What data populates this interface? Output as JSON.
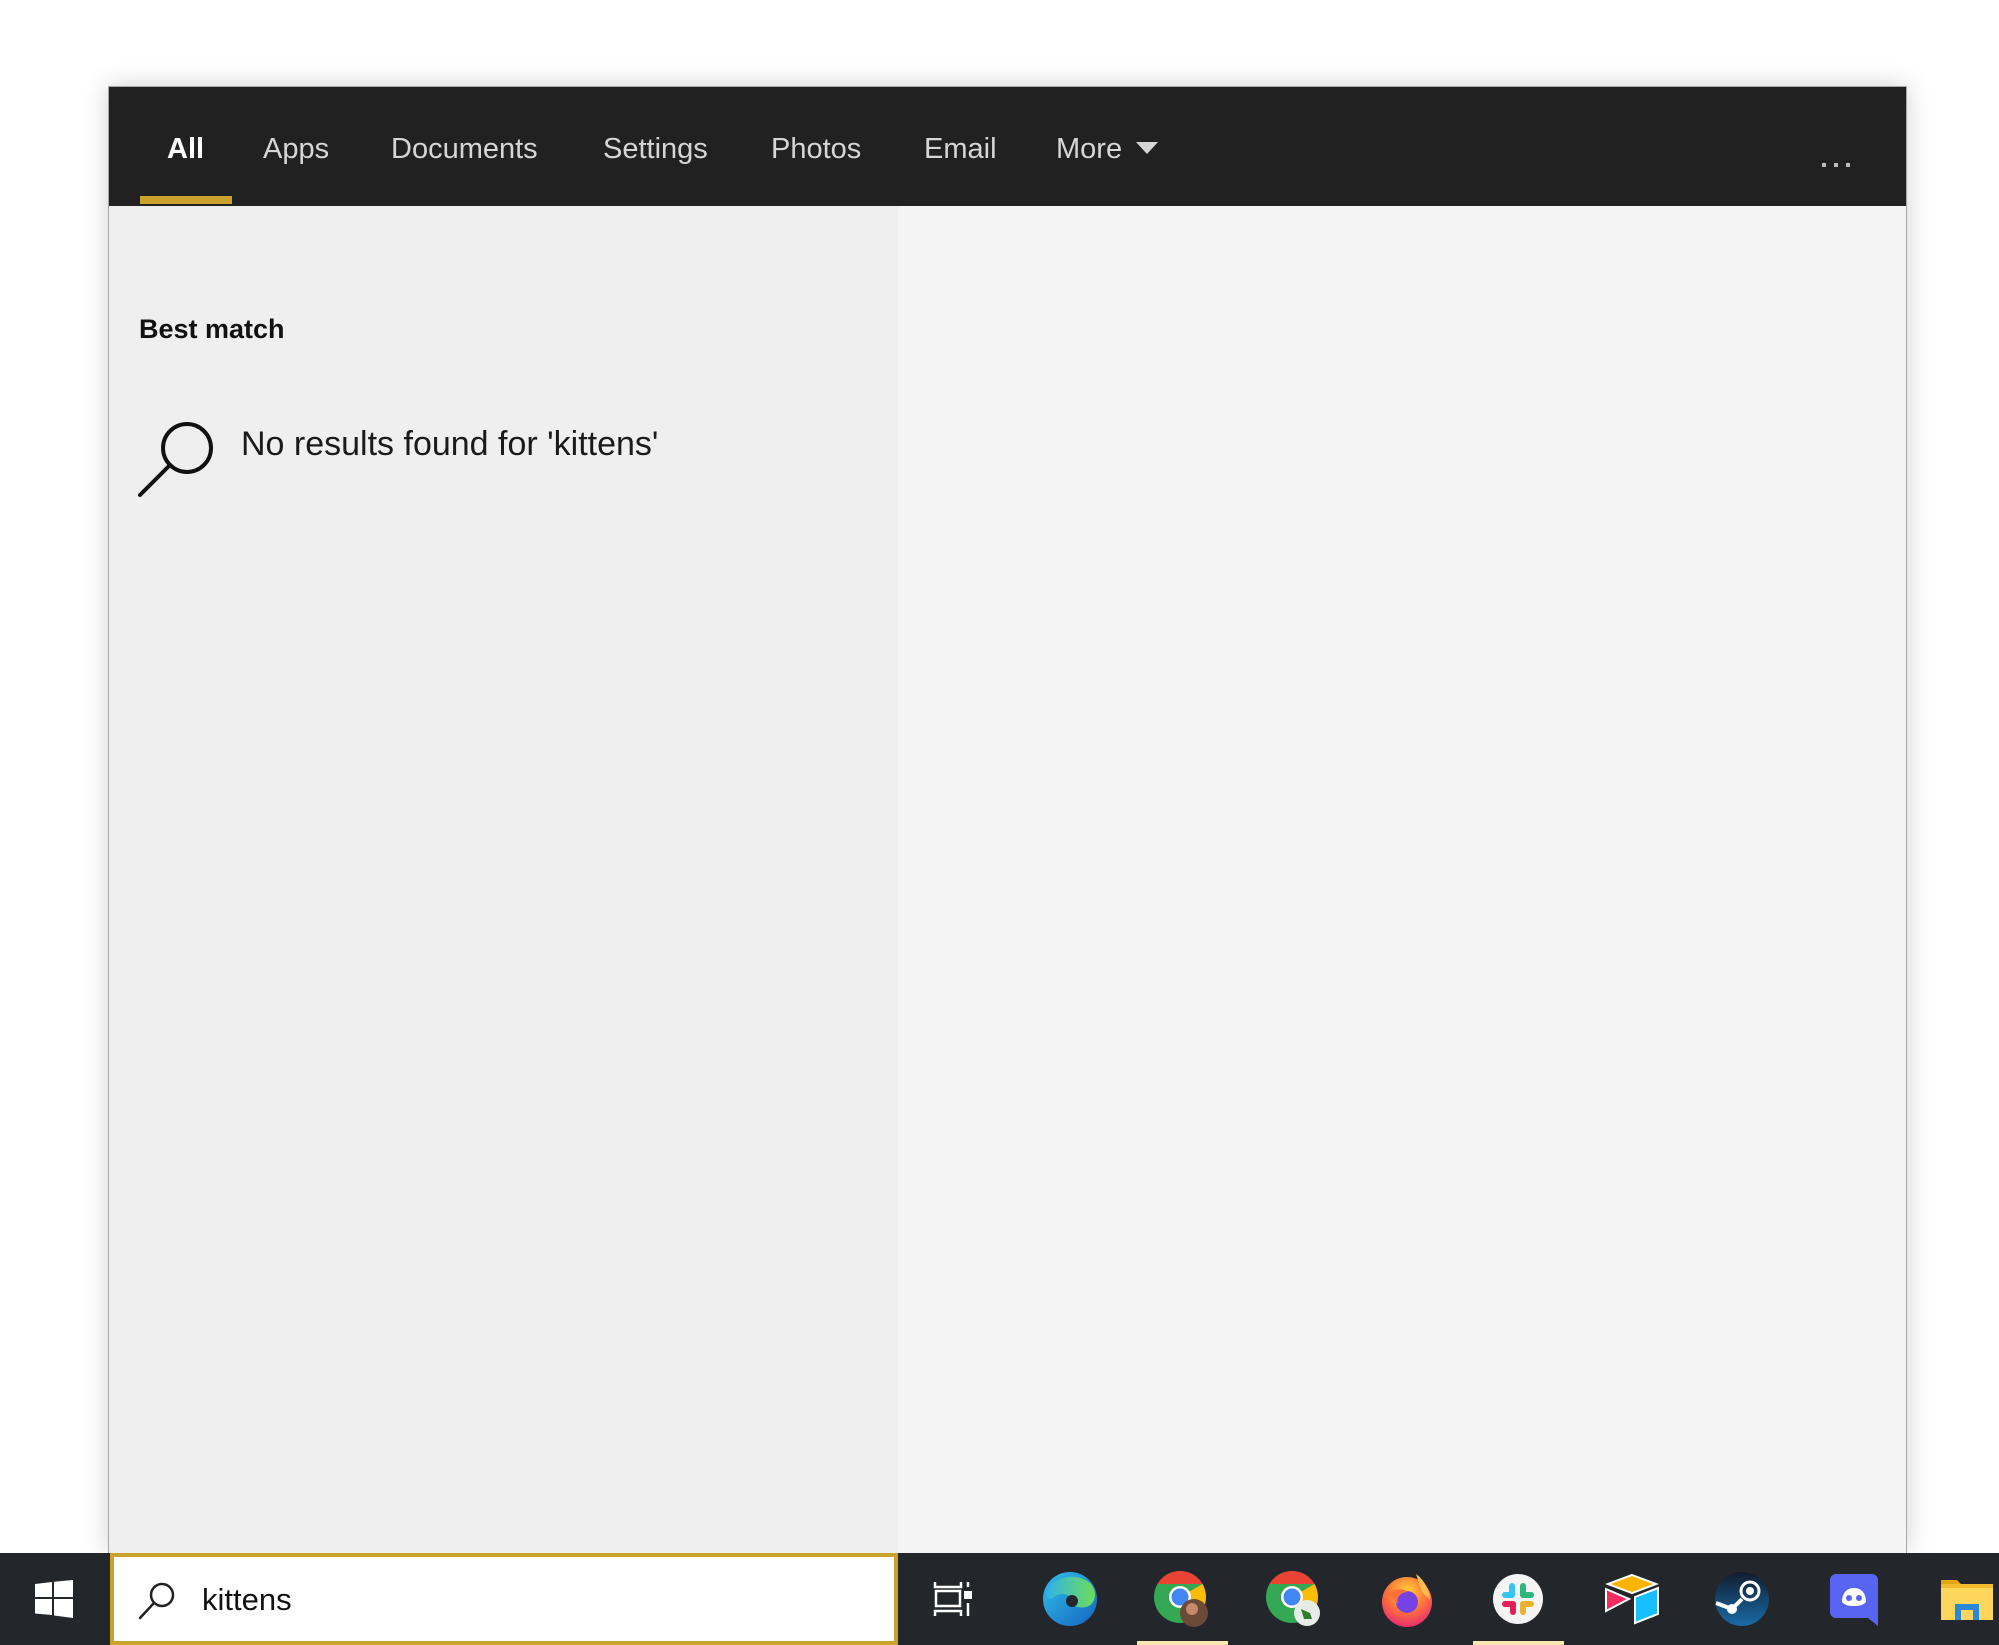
{
  "search_panel": {
    "tabs": [
      {
        "label": "All",
        "active": true
      },
      {
        "label": "Apps"
      },
      {
        "label": "Documents"
      },
      {
        "label": "Settings"
      },
      {
        "label": "Photos"
      },
      {
        "label": "Email"
      },
      {
        "label": "More"
      }
    ],
    "more_menu_icon": "ellipsis-icon",
    "section_title": "Best match",
    "result_text": "No results found for 'kittens'",
    "result_icon": "search-icon",
    "accent_color": "#c9a22b"
  },
  "taskbar": {
    "search": {
      "value": "kittens",
      "placeholder": "Type here to search"
    },
    "pinned_apps": [
      {
        "name": "Task View",
        "running": false
      },
      {
        "name": "Microsoft Edge",
        "running": false
      },
      {
        "name": "Google Chrome (profile 1)",
        "running": true
      },
      {
        "name": "Google Chrome (profile 2)",
        "running": false
      },
      {
        "name": "Firefox",
        "running": false
      },
      {
        "name": "Slack",
        "running": true
      },
      {
        "name": "Airtable",
        "running": false
      },
      {
        "name": "Steam",
        "running": false
      },
      {
        "name": "Discord",
        "running": false
      },
      {
        "name": "File Explorer",
        "running": false
      }
    ]
  }
}
